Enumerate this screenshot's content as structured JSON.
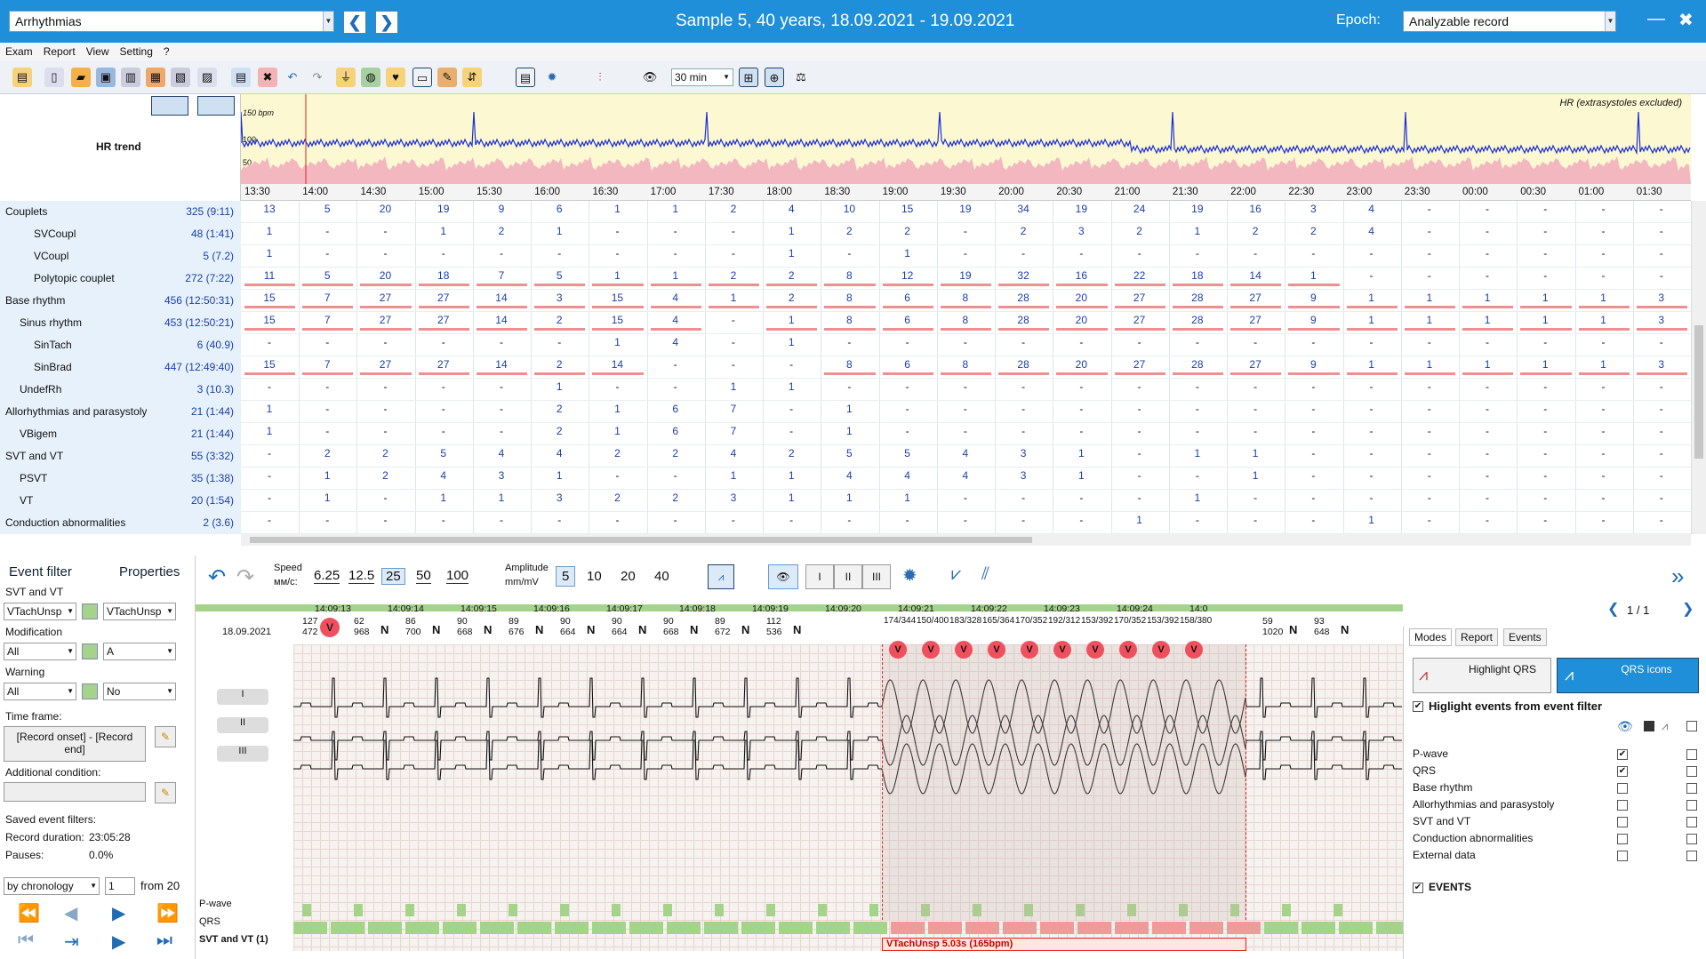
{
  "titlebar": {
    "module": "Arrhythmias",
    "title": "Sample 5, 40 years, 18.09.2021 - 19.09.2021",
    "epoch_label": "Epoch:",
    "epoch_value": "Analyzable record",
    "min": "—",
    "close": "✖"
  },
  "menu": [
    "Exam",
    "Report",
    "View",
    "Setting",
    "?"
  ],
  "toolbar": {
    "zoom": "30 min"
  },
  "trend": {
    "label": "HR trend",
    "y150": "150 bpm",
    "y100": "100",
    "y50": "50",
    "legend": "HR (extrasystoles excluded)",
    "times": [
      "13:30",
      "14:00",
      "14:30",
      "15:00",
      "15:30",
      "16:00",
      "16:30",
      "17:00",
      "17:30",
      "18:00",
      "18:30",
      "19:00",
      "19:30",
      "20:00",
      "20:30",
      "21:00",
      "21:30",
      "22:00",
      "22:30",
      "23:00",
      "23:30",
      "00:00",
      "00:30",
      "01:00",
      "01:30"
    ]
  },
  "table": {
    "rows": [
      {
        "name": "Couplets",
        "value": "325 (9:11)",
        "indent": 0,
        "cells": [
          "13",
          "5",
          "20",
          "19",
          "9",
          "6",
          "1",
          "1",
          "2",
          "4",
          "10",
          "15",
          "19",
          "34",
          "19",
          "24",
          "19",
          "16",
          "3",
          "4",
          "-",
          "-",
          "-",
          "-",
          "-"
        ]
      },
      {
        "name": "SVCoupl",
        "value": "48 (1:41)",
        "indent": 2,
        "cells": [
          "1",
          "-",
          "-",
          "1",
          "2",
          "1",
          "-",
          "-",
          "-",
          "1",
          "2",
          "2",
          "-",
          "2",
          "3",
          "2",
          "1",
          "2",
          "2",
          "4",
          "-",
          "-",
          "-",
          "-",
          "-"
        ]
      },
      {
        "name": "VCoupl",
        "value": "5 (7.2)",
        "indent": 2,
        "cells": [
          "1",
          "-",
          "-",
          "-",
          "-",
          "-",
          "-",
          "-",
          "-",
          "1",
          "-",
          "1",
          "-",
          "-",
          "-",
          "-",
          "-",
          "-",
          "-",
          "-",
          "-",
          "-",
          "-",
          "-",
          "-"
        ]
      },
      {
        "name": "Polytopic couplet",
        "value": "272 (7:22)",
        "indent": 2,
        "cells": [
          "11",
          "5",
          "20",
          "18",
          "7",
          "5",
          "1",
          "1",
          "2",
          "2",
          "8",
          "12",
          "19",
          "32",
          "16",
          "22",
          "18",
          "14",
          "1",
          "-",
          "-",
          "-",
          "-",
          "-",
          "-"
        ]
      },
      {
        "name": "Base rhythm",
        "value": "456 (12:50:31)",
        "indent": 0,
        "cells": [
          "15",
          "7",
          "27",
          "27",
          "14",
          "3",
          "15",
          "4",
          "1",
          "2",
          "8",
          "6",
          "8",
          "28",
          "20",
          "27",
          "28",
          "27",
          "9",
          "1",
          "1",
          "1",
          "1",
          "1",
          "3"
        ]
      },
      {
        "name": "Sinus rhythm",
        "value": "453 (12:50:21)",
        "indent": 1,
        "cells": [
          "15",
          "7",
          "27",
          "27",
          "14",
          "2",
          "15",
          "4",
          "-",
          "1",
          "8",
          "6",
          "8",
          "28",
          "20",
          "27",
          "28",
          "27",
          "9",
          "1",
          "1",
          "1",
          "1",
          "1",
          "3"
        ]
      },
      {
        "name": "SinTach",
        "value": "6 (40.9)",
        "indent": 2,
        "cells": [
          "-",
          "-",
          "-",
          "-",
          "-",
          "-",
          "1",
          "4",
          "-",
          "1",
          "-",
          "-",
          "-",
          "-",
          "-",
          "-",
          "-",
          "-",
          "-",
          "-",
          "-",
          "-",
          "-",
          "-",
          "-"
        ]
      },
      {
        "name": "SinBrad",
        "value": "447 (12:49:40)",
        "indent": 2,
        "cells": [
          "15",
          "7",
          "27",
          "27",
          "14",
          "2",
          "14",
          "-",
          "-",
          "-",
          "8",
          "6",
          "8",
          "28",
          "20",
          "27",
          "28",
          "27",
          "9",
          "1",
          "1",
          "1",
          "1",
          "1",
          "3"
        ]
      },
      {
        "name": "UndefRh",
        "value": "3 (10.3)",
        "indent": 1,
        "cells": [
          "-",
          "-",
          "-",
          "-",
          "-",
          "1",
          "-",
          "-",
          "1",
          "1",
          "-",
          "-",
          "-",
          "-",
          "-",
          "-",
          "-",
          "-",
          "-",
          "-",
          "-",
          "-",
          "-",
          "-",
          "-"
        ]
      },
      {
        "name": "Allorhythmias and parasystoly",
        "value": "21 (1:44)",
        "indent": 0,
        "cells": [
          "1",
          "-",
          "-",
          "-",
          "-",
          "2",
          "1",
          "6",
          "7",
          "-",
          "1",
          "-",
          "-",
          "-",
          "-",
          "-",
          "-",
          "-",
          "-",
          "-",
          "-",
          "-",
          "-",
          "-",
          "-"
        ]
      },
      {
        "name": "VBigem",
        "value": "21 (1:44)",
        "indent": 1,
        "cells": [
          "1",
          "-",
          "-",
          "-",
          "-",
          "2",
          "1",
          "6",
          "7",
          "-",
          "1",
          "-",
          "-",
          "-",
          "-",
          "-",
          "-",
          "-",
          "-",
          "-",
          "-",
          "-",
          "-",
          "-",
          "-"
        ]
      },
      {
        "name": "SVT and VT",
        "value": "55 (3:32)",
        "indent": 0,
        "cells": [
          "-",
          "2",
          "2",
          "5",
          "4",
          "4",
          "2",
          "2",
          "4",
          "2",
          "5",
          "5",
          "4",
          "3",
          "1",
          "-",
          "1",
          "1",
          "-",
          "-",
          "-",
          "-",
          "-",
          "-",
          "-"
        ]
      },
      {
        "name": "PSVT",
        "value": "35 (1:38)",
        "indent": 1,
        "cells": [
          "-",
          "1",
          "2",
          "4",
          "3",
          "1",
          "-",
          "-",
          "1",
          "1",
          "4",
          "4",
          "4",
          "3",
          "1",
          "-",
          "-",
          "1",
          "-",
          "-",
          "-",
          "-",
          "-",
          "-",
          "-"
        ]
      },
      {
        "name": "VT",
        "value": "20 (1:54)",
        "indent": 1,
        "cells": [
          "-",
          "1",
          "-",
          "1",
          "1",
          "3",
          "2",
          "2",
          "3",
          "1",
          "1",
          "1",
          "-",
          "-",
          "-",
          "-",
          "1",
          "-",
          "-",
          "-",
          "-",
          "-",
          "-",
          "-",
          "-"
        ]
      },
      {
        "name": "Conduction abnormalities",
        "value": "2 (3.6)",
        "indent": 0,
        "cells": [
          "-",
          "-",
          "-",
          "-",
          "-",
          "-",
          "-",
          "-",
          "-",
          "-",
          "-",
          "-",
          "-",
          "-",
          "-",
          "1",
          "-",
          "-",
          "-",
          "1",
          "-",
          "-",
          "-",
          "-",
          "-"
        ]
      }
    ]
  },
  "left_panel": {
    "event_filter": "Event filter",
    "properties": "Properties",
    "group": "SVT and VT",
    "combo1": "VTachUnsp",
    "combo2": "VTachUnsp",
    "modification_lbl": "Modification",
    "modification": "All",
    "mod_value": "A",
    "warning_lbl": "Warning",
    "warning": "All",
    "warning_value": "No",
    "timeframe_lbl": "Time frame:",
    "timeframe": "[Record onset] - [Record end]",
    "additional_lbl": "Additional condition:",
    "saved_lbl": "Saved event filters:",
    "duration_lbl": "Record duration:",
    "duration": "23:05:28",
    "pauses_lbl": "Pauses:",
    "pauses": "0.0%",
    "sort": "by chronology",
    "page": "1",
    "from": "from 20"
  },
  "ctrl": {
    "speed_lbl": "Speed",
    "speed_unit": "мм/с:",
    "speeds": [
      "6.25",
      "12.5",
      "25",
      "50",
      "100"
    ],
    "amp_lbl": "Amplitude",
    "amp_unit": "mm/mV",
    "amps": [
      "5",
      "10",
      "20",
      "40"
    ],
    "leads": [
      "I",
      "II",
      "III"
    ],
    "pages": "1 / 1"
  },
  "ecg": {
    "date": "18.09.2021",
    "times": [
      "14:09:13",
      "14:09:14",
      "14:09:15",
      "14:09:16",
      "14:09:17",
      "14:09:18",
      "14:09:19",
      "14:09:20",
      "14:09:21",
      "14:09:22",
      "14:09:23",
      "14:09:24",
      "14:0"
    ],
    "beats": [
      {
        "top": "127",
        "bot": "472",
        "lbl": "V"
      },
      {
        "top": "62",
        "bot": "968",
        "lbl": "N"
      },
      {
        "top": "86",
        "bot": "700",
        "lbl": "N"
      },
      {
        "top": "90",
        "bot": "668",
        "lbl": "N"
      },
      {
        "top": "89",
        "bot": "676",
        "lbl": "N"
      },
      {
        "top": "90",
        "bot": "664",
        "lbl": "N"
      },
      {
        "top": "90",
        "bot": "664",
        "lbl": "N"
      },
      {
        "top": "90",
        "bot": "668",
        "lbl": "N"
      },
      {
        "top": "89",
        "bot": "672",
        "lbl": "N"
      },
      {
        "top": "112",
        "bot": "536",
        "lbl": "N"
      }
    ],
    "vt_pairs": [
      "174/344",
      "150/400",
      "183/328",
      "165/364",
      "170/352",
      "192/312",
      "153/392",
      "170/352",
      "153/392",
      "158/380"
    ],
    "tail": [
      {
        "top": "59",
        "bot": "1020",
        "lbl": "N"
      },
      {
        "top": "93",
        "bot": "648",
        "lbl": "N"
      }
    ],
    "leads": [
      "I",
      "II",
      "III"
    ],
    "track_labels": [
      "P-wave",
      "QRS",
      "SVT and VT (1)"
    ],
    "event_label": "VTachUnsp 5.03s (165bpm)"
  },
  "right_panel": {
    "tabs": [
      "Modes",
      "Report",
      "Events"
    ],
    "highlight_qrs": "Highlight QRS",
    "qrs_icons": "QRS icons",
    "highlight_events": "Higlight events from event filter",
    "items": [
      "P-wave",
      "QRS",
      "Base rhythm",
      "Allorhythmias and parasystoly",
      "SVT and VT",
      "Conduction abnormalities",
      "External data"
    ],
    "events": "EVENTS"
  }
}
